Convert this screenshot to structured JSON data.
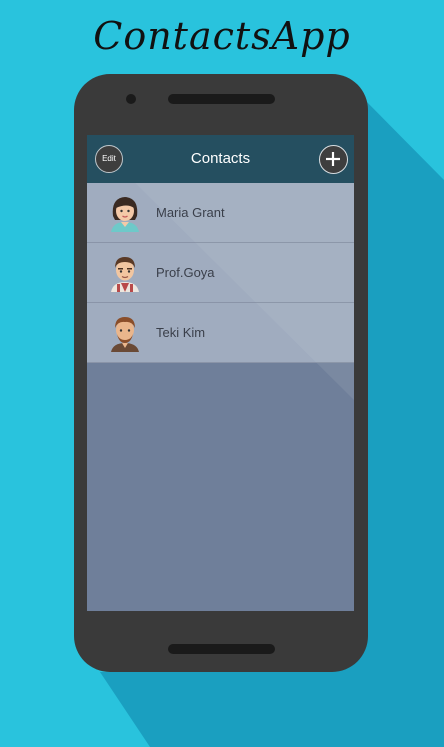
{
  "app_title": "ContactsApp",
  "header": {
    "edit_label": "Edit",
    "title": "Contacts",
    "add_icon": "plus-icon"
  },
  "contacts": [
    {
      "name": "Maria Grant",
      "avatar": "female-avatar"
    },
    {
      "name": "Prof.Goya",
      "avatar": "male-avatar"
    },
    {
      "name": "Teki Kim",
      "avatar": "male-avatar"
    }
  ],
  "colors": {
    "background": "#29c3dd",
    "phone_body": "#3a3a3a",
    "header": "#254f60",
    "screen": "#6f7f9a"
  }
}
